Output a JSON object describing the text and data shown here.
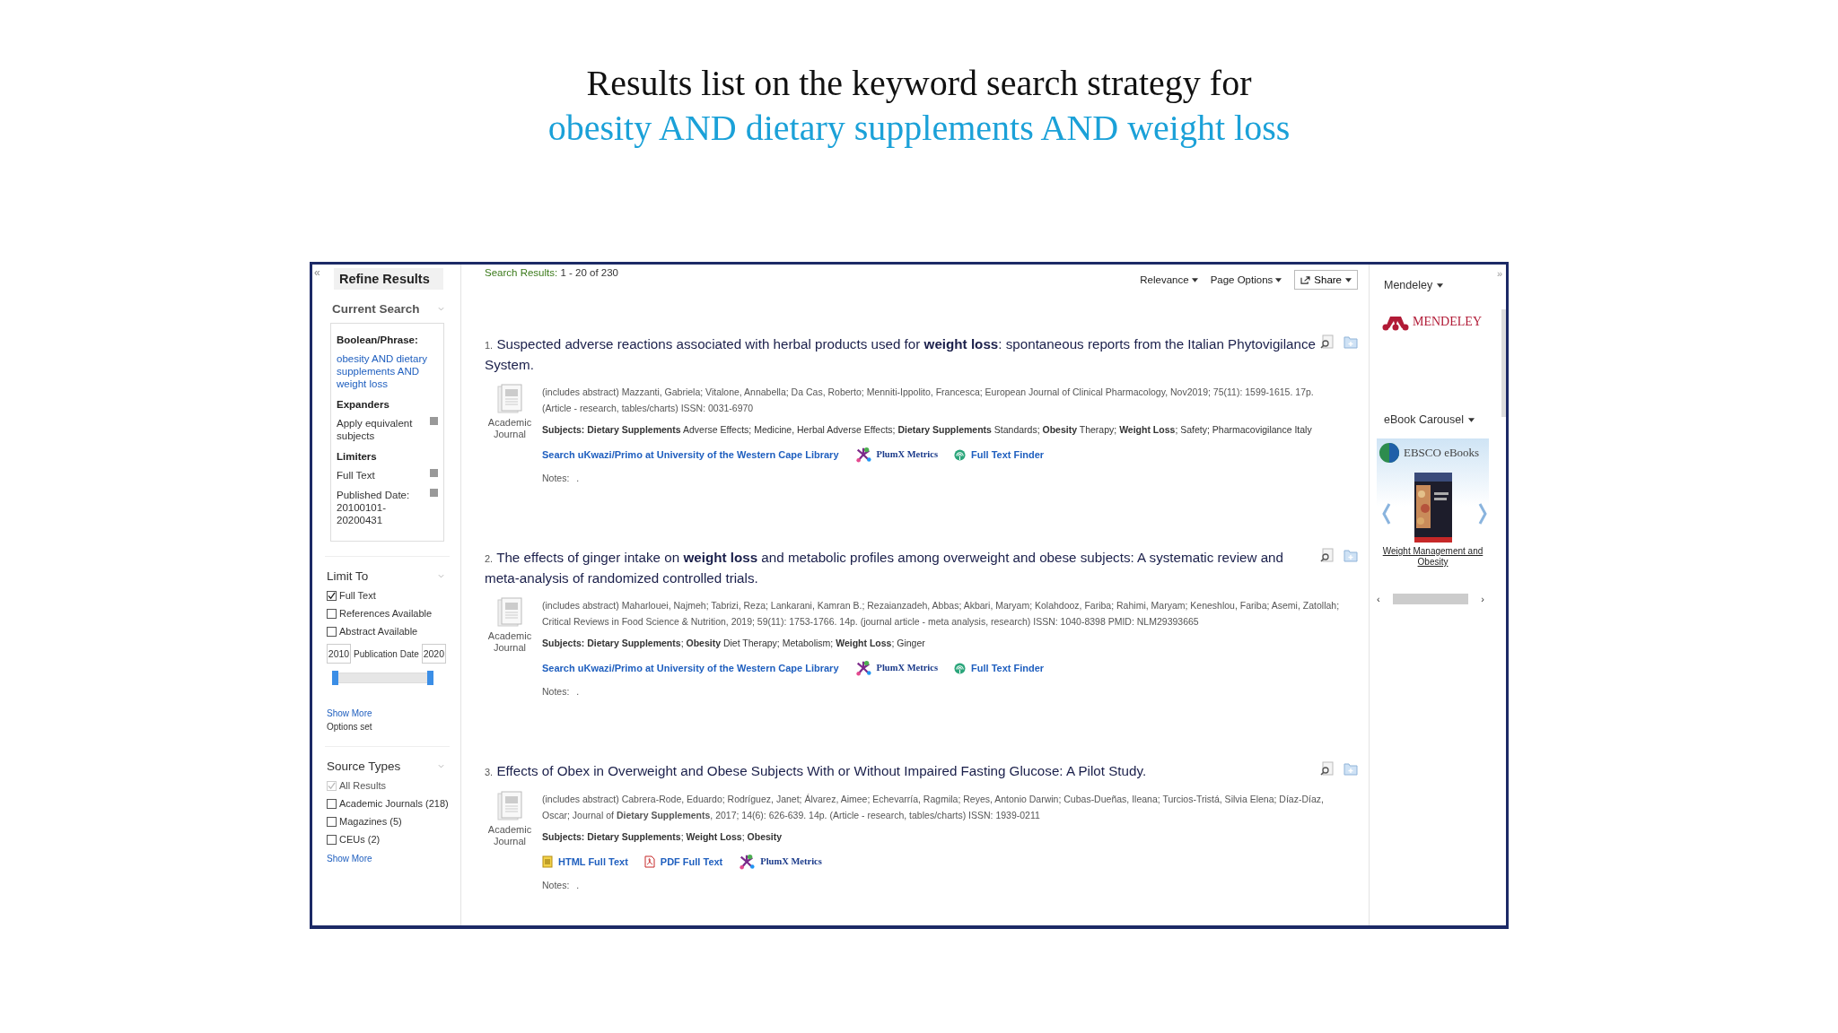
{
  "slide_title": {
    "line1": "Results list on the keyword search strategy for",
    "line2": "obesity AND dietary supplements AND weight loss"
  },
  "sidebar": {
    "collapse": "«",
    "title": "Refine Results",
    "current_search": {
      "heading": "Current Search",
      "sections": [
        {
          "label": "Boolean/Phrase:",
          "entries": [
            {
              "text": "obesity AND dietary supplements AND weight loss",
              "kind": "query"
            }
          ]
        },
        {
          "label": "Expanders",
          "entries": [
            {
              "text": "Apply equivalent subjects",
              "kind": "filter"
            }
          ]
        },
        {
          "label": "Limiters",
          "entries": [
            {
              "text": "Full Text",
              "kind": "filter"
            },
            {
              "text": "Published Date: 20100101-20200431",
              "kind": "filter"
            }
          ]
        }
      ]
    },
    "limit_to": {
      "heading": "Limit To",
      "options": [
        {
          "label": "Full Text",
          "checked": true,
          "disabled": false
        },
        {
          "label": "References Available",
          "checked": false,
          "disabled": false
        },
        {
          "label": "Abstract Available",
          "checked": false,
          "disabled": false
        }
      ],
      "date_from": "2010",
      "date_label": "Publication Date",
      "date_to": "2020",
      "range_thumbs": [
        {
          "level": 0
        },
        {
          "level": 1
        }
      ],
      "show_more": "Show More",
      "options_set": "Options set"
    },
    "source_types": {
      "heading": "Source Types",
      "options": [
        {
          "label": "All Results",
          "checked": true,
          "disabled": true
        },
        {
          "label": "Academic Journals (218)",
          "checked": false,
          "disabled": false
        },
        {
          "label": "Magazines (5)",
          "checked": false,
          "disabled": false
        },
        {
          "label": "CEUs (2)",
          "checked": false,
          "disabled": false
        }
      ],
      "show_more": "Show More"
    }
  },
  "toolbar": {
    "results_label": "Search Results:",
    "results_range": "1 - 20 of 230",
    "sort": "Relevance",
    "page_options": "Page Options",
    "share": "Share"
  },
  "results": [
    {
      "number": "1.",
      "title": "Suspected adverse reactions associated with herbal products used for **weight loss**: spontaneous reports from the Italian Phytovigilance System.",
      "doc_type": "Academic Journal",
      "meta": "(includes abstract) Mazzanti, Gabriela; Vitalone, Annabella; Da Cas, Roberto; Menniti-Ippolito, Francesca; European Journal of Clinical Pharmacology, Nov2019; 75(11): 1599-1615. 17p. (Article - research, tables/charts) ISSN: 0031-6970",
      "subjects": "**Subjects: Dietary Supplements** Adverse Effects; Medicine, Herbal Adverse Effects; **Dietary Supplements** Standards; **Obesity** Therapy; **Weight Loss**; Safety; Pharmacovigilance Italy",
      "links": [
        {
          "label": "Search uKwazi/Primo at University of the Western Cape Library",
          "kind": "search"
        },
        {
          "label": "PlumX Metrics",
          "kind": "plumx"
        },
        {
          "label": "Full Text Finder",
          "kind": "finder"
        }
      ],
      "notes_label": "Notes:",
      "notes": "."
    },
    {
      "number": "2.",
      "title": "The effects of ginger intake on **weight loss** and metabolic profiles among overweight and obese subjects: A systematic review and meta-analysis of randomized controlled trials.",
      "doc_type": "Academic Journal",
      "meta": "(includes abstract) Maharlouei, Najmeh; Tabrizi, Reza; Lankarani, Kamran B.; Rezaianzadeh, Abbas; Akbari, Maryam; Kolahdooz, Fariba; Rahimi, Maryam; Keneshlou, Fariba; Asemi, Zatollah; Critical Reviews in Food Science & Nutrition, 2019; 59(11): 1753-1766. 14p. (journal article - meta analysis, research) ISSN: 1040-8398 PMID: NLM29393665",
      "subjects": "**Subjects: Dietary Supplements**; **Obesity** Diet Therapy; Metabolism; **Weight Loss**; Ginger",
      "links": [
        {
          "label": "Search uKwazi/Primo at University of the Western Cape Library",
          "kind": "search"
        },
        {
          "label": "PlumX Metrics",
          "kind": "plumx"
        },
        {
          "label": "Full Text Finder",
          "kind": "finder"
        }
      ],
      "notes_label": "Notes:",
      "notes": "."
    },
    {
      "number": "3.",
      "title": "Effects of Obex in Overweight and Obese Subjects With or Without Impaired Fasting Glucose: A Pilot Study.",
      "doc_type": "Academic Journal",
      "meta": "(includes abstract) Cabrera-Rode, Eduardo; Rodríguez, Janet; Álvarez, Aimee; Echevarría, Ragmila; Reyes, Antonio Darwin; Cubas-Dueñas, Ileana; Turcios-Tristá, Silvia Elena; Díaz-Díaz, Oscar; Journal of **Dietary Supplements**, 2017; 14(6): 626-639. 14p. (Article - research, tables/charts) ISSN: 1939-0211",
      "subjects": "**Subjects: Dietary Supplements**; **Weight Loss**; **Obesity**",
      "links": [
        {
          "label": "HTML Full Text",
          "kind": "html"
        },
        {
          "label": "PDF Full Text",
          "kind": "pdf"
        },
        {
          "label": "PlumX Metrics",
          "kind": "plumx"
        }
      ],
      "notes_label": "Notes:",
      "notes": "."
    }
  ],
  "right_panel": {
    "expand": "»",
    "mendeley_label": "Mendeley",
    "mendeley_logo": "MENDELEY",
    "carousel_label": "eBook Carousel",
    "ebsco_logo": "EBSCO eBooks",
    "book_title": "Weight Management and Obesity",
    "scroll_left": "‹",
    "scroll_right": "›"
  }
}
